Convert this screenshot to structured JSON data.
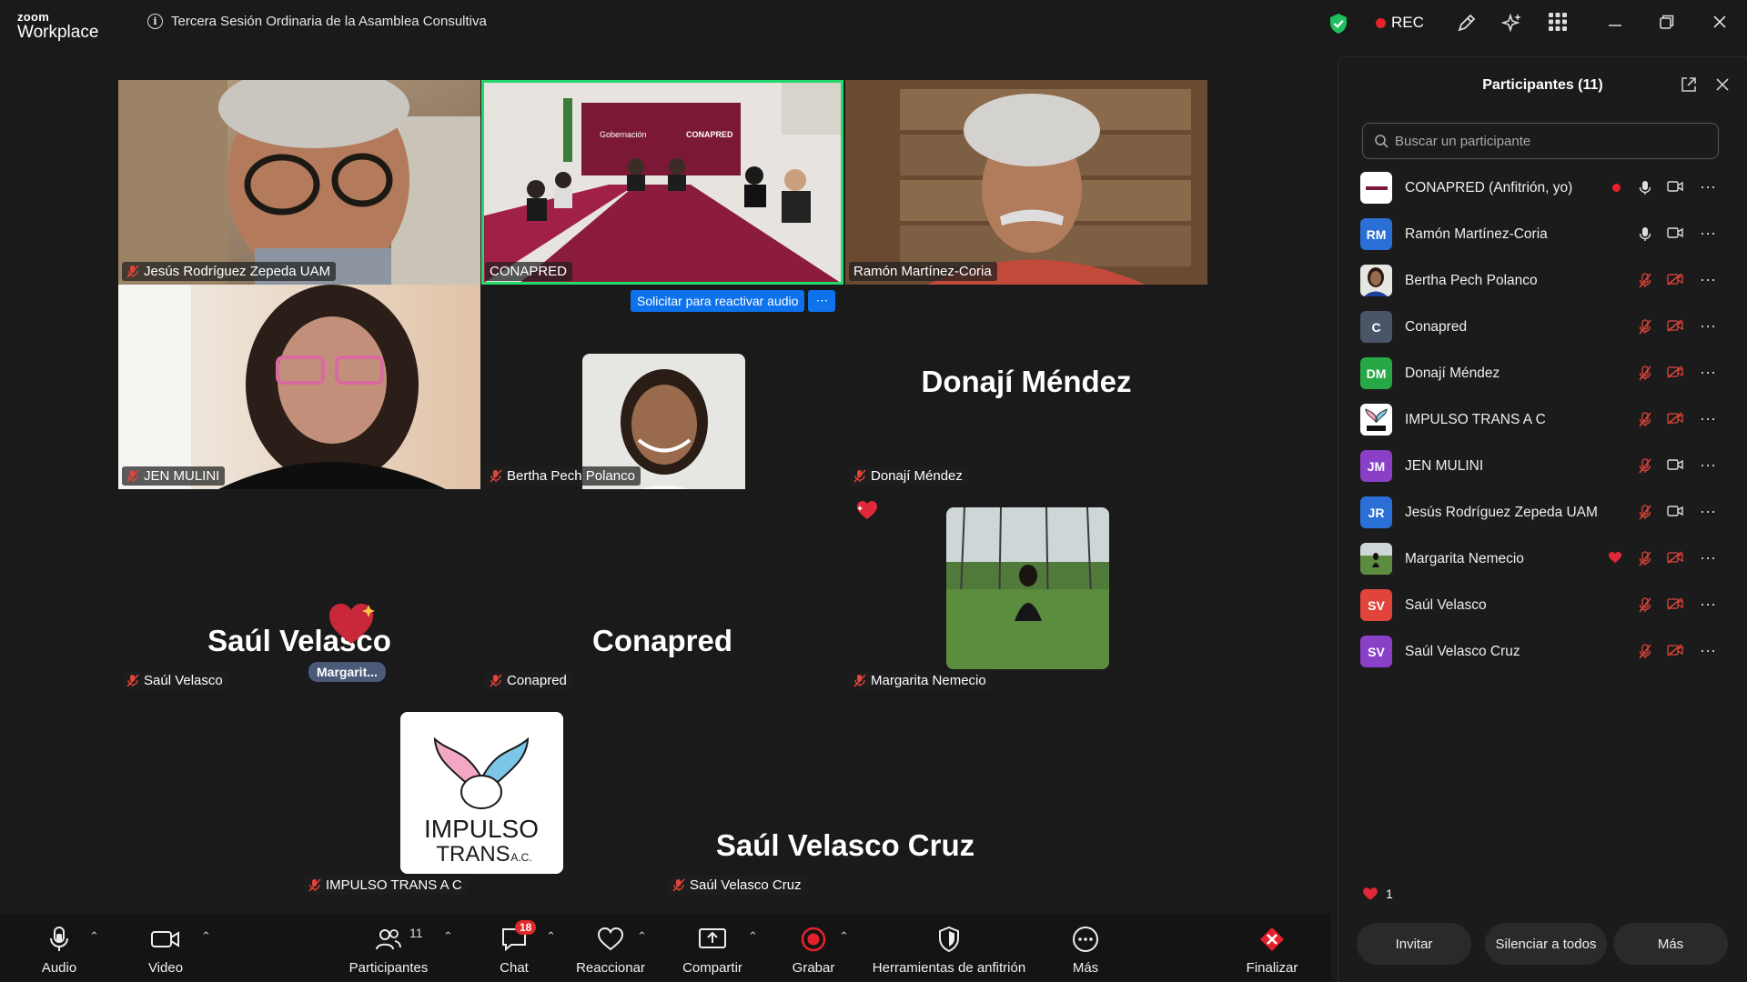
{
  "app": {
    "brand_top": "zoom",
    "brand_bottom": "Workplace",
    "meeting_title": "Tercera Sesión Ordinaria de la Asamblea Consultiva",
    "rec_label": "REC"
  },
  "gallery": {
    "tiles": [
      {
        "name": "Jesús Rodríguez Zepeda UAM"
      },
      {
        "name": "CONAPRED"
      },
      {
        "name": "Ramón Martínez-Coria"
      },
      {
        "name": "JEN MULINI"
      },
      {
        "name": "Bertha Pech Polanco"
      },
      {
        "name": "Donají Méndez",
        "display": "Donají Méndez"
      },
      {
        "name": "Saúl Velasco",
        "display": "Saúl Velasco"
      },
      {
        "name": "Conapred",
        "display": "Conapred"
      },
      {
        "name": "Margarita Nemecio"
      },
      {
        "name": "IMPULSO TRANS A C"
      },
      {
        "name": "Saúl Velasco Cruz",
        "display": "Saúl Velasco Cruz"
      }
    ],
    "unmute_request": "Solicitar para reactivar audio",
    "reaction_name_tag": "Margarit...",
    "room_sign_1": "Gobernación",
    "room_sign_2": "CONAPRED",
    "impulso_line1": "IMPULSO",
    "impulso_line2": "TRANS",
    "impulso_suffix": "A.C."
  },
  "toolbar": {
    "audio": "Audio",
    "video": "Video",
    "participants": "Participantes",
    "participants_count": "11",
    "chat": "Chat",
    "chat_badge": "18",
    "react": "Reaccionar",
    "share": "Compartir",
    "record": "Grabar",
    "host_tools": "Herramientas de anfitrión",
    "more": "Más",
    "end": "Finalizar"
  },
  "panel": {
    "title": "Participantes (11)",
    "search_placeholder": "Buscar un participante",
    "participants": [
      {
        "initials": "",
        "name": "CONAPRED (Anfitrión, yo)",
        "color": "#ffffff"
      },
      {
        "initials": "RM",
        "name": "Ramón Martínez-Coria",
        "color": "#2a6fd6"
      },
      {
        "initials": "",
        "name": "Bertha Pech Polanco",
        "color": "#6a6a6a"
      },
      {
        "initials": "C",
        "name": "Conapred",
        "color": "#4a5568"
      },
      {
        "initials": "DM",
        "name": "Donají Méndez",
        "color": "#27a745"
      },
      {
        "initials": "",
        "name": "IMPULSO TRANS A C",
        "color": "#ffffff"
      },
      {
        "initials": "JM",
        "name": "JEN MULINI",
        "color": "#8a3fc7"
      },
      {
        "initials": "JR",
        "name": "Jesús Rodríguez Zepeda UAM",
        "color": "#2a6fd6"
      },
      {
        "initials": "",
        "name": "Margarita Nemecio",
        "color": "#5a6b4a"
      },
      {
        "initials": "SV",
        "name": "Saúl Velasco",
        "color": "#e0443a"
      },
      {
        "initials": "SV",
        "name": "Saúl Velasco Cruz",
        "color": "#8a3fc7"
      }
    ],
    "reaction_count": "1",
    "invite": "Invitar",
    "mute_all": "Silenciar a todos",
    "more": "Más"
  }
}
